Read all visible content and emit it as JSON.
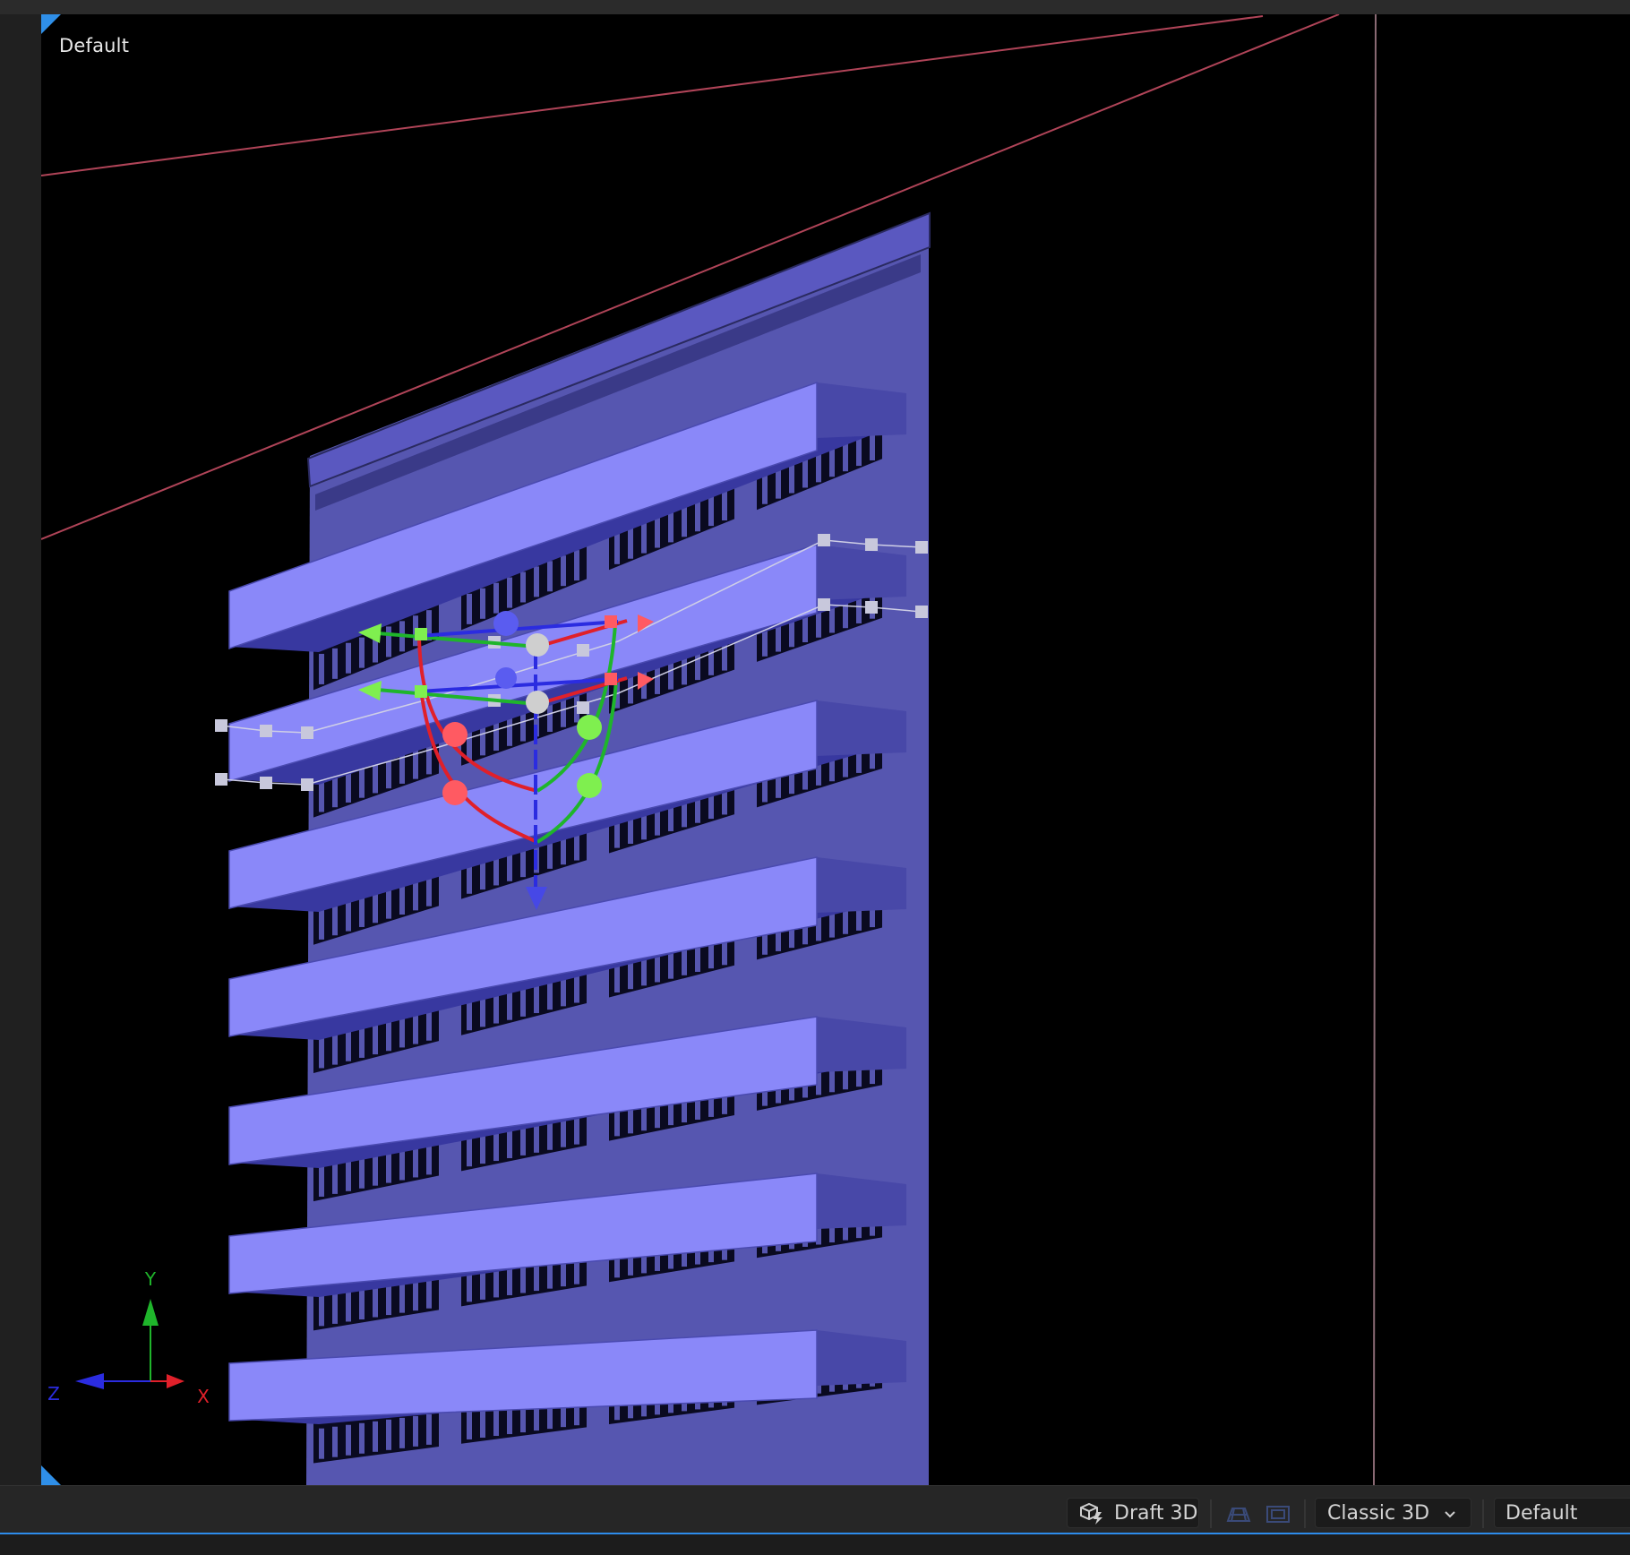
{
  "viewport": {
    "view_label": "Default"
  },
  "axis_gizmo": {
    "y_label": "Y",
    "x_label": "X",
    "z_label": "Z",
    "colors": {
      "x": "#e0202a",
      "y": "#1fb52b",
      "z": "#2b2ce0"
    }
  },
  "toolbar": {
    "draft_3d_label": "Draft 3D",
    "renderer_label": "Classic 3D",
    "view_select_label": "Default"
  },
  "scene": {
    "building_color": "#5656b0",
    "panel_color": "#8a88f9",
    "accent_line_color": "#b04458",
    "selection_color": "#d0d0e0"
  },
  "icons": [
    "draft-3d-icon",
    "grid-icon",
    "safe-zones-icon",
    "chevron-down-icon"
  ]
}
